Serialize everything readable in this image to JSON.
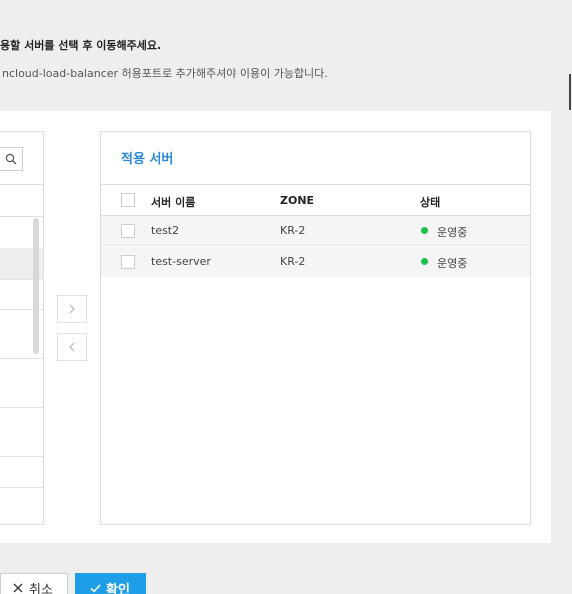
{
  "instructions": {
    "line1": "용할 서버를 선택 후 이동해주세요.",
    "line2": "ncloud-load-balancer 허용포트로 추가해주셔야 이용이 가능합니다."
  },
  "selected_servers": {
    "title": "적용 서버",
    "columns": {
      "name": "서버 이름",
      "zone": "ZONE",
      "status": "상태"
    },
    "rows": [
      {
        "name": "test2",
        "zone": "KR-2",
        "status": "운영중"
      },
      {
        "name": "test-server",
        "zone": "KR-2",
        "status": "운영중"
      }
    ]
  },
  "colors": {
    "accent": "#1f9ee8",
    "title_blue": "#2b8ad8",
    "status_running": "#19c24a"
  },
  "buttons": {
    "cancel": "취소",
    "ok": "확인"
  },
  "icons": {
    "search": "search-icon",
    "move_right": "chevron-right-icon",
    "move_left": "chevron-left-icon",
    "cancel": "close-icon",
    "ok": "check-icon"
  }
}
